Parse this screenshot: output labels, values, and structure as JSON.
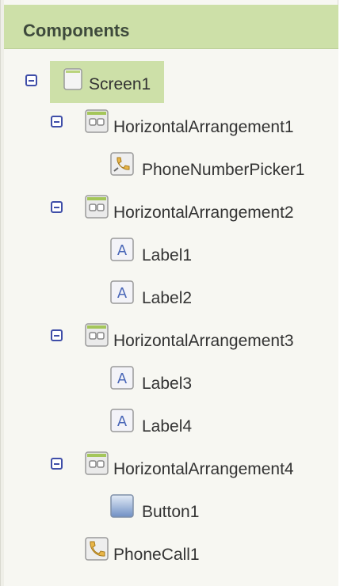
{
  "panel": {
    "title": "Components"
  },
  "tree": {
    "screen": {
      "label": "Screen1",
      "icon": "screen-icon",
      "selected": true
    },
    "items": [
      {
        "label": "HorizontalArrangement1",
        "icon": "horizontal-arrangement-icon"
      },
      {
        "label": "PhoneNumberPicker1",
        "icon": "phone-number-picker-icon"
      },
      {
        "label": "HorizontalArrangement2",
        "icon": "horizontal-arrangement-icon"
      },
      {
        "label": "Label1",
        "icon": "label-icon"
      },
      {
        "label": "Label2",
        "icon": "label-icon"
      },
      {
        "label": "HorizontalArrangement3",
        "icon": "horizontal-arrangement-icon"
      },
      {
        "label": "Label3",
        "icon": "label-icon"
      },
      {
        "label": "Label4",
        "icon": "label-icon"
      },
      {
        "label": "HorizontalArrangement4",
        "icon": "horizontal-arrangement-icon"
      },
      {
        "label": "Button1",
        "icon": "button-icon"
      },
      {
        "label": "PhoneCall1",
        "icon": "phone-call-icon"
      }
    ]
  },
  "colors": {
    "header_bg": "#cde0a8",
    "selected_bg": "#cde0a8",
    "toggle_border": "#3f4ea8",
    "text": "#333333"
  }
}
